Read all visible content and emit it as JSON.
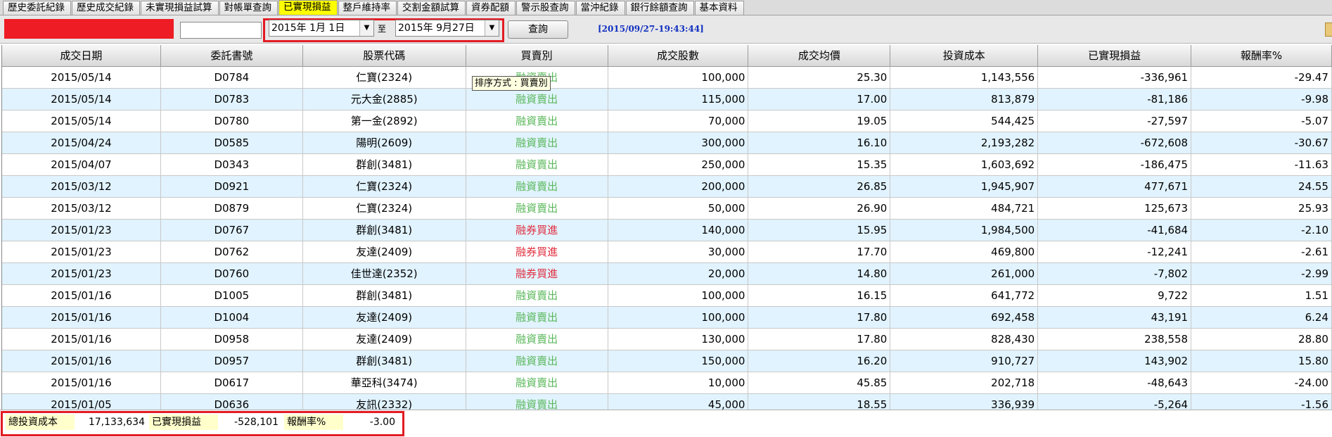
{
  "tabs": [
    {
      "label": "歷史委託紀錄",
      "active": false
    },
    {
      "label": "歷史成交紀錄",
      "active": false
    },
    {
      "label": "未實現損益試算",
      "active": false
    },
    {
      "label": "對帳單查詢",
      "active": false
    },
    {
      "label": "已實現損益",
      "active": true
    },
    {
      "label": "整戶維持率",
      "active": false
    },
    {
      "label": "交割金額試算",
      "active": false
    },
    {
      "label": "資券配額",
      "active": false
    },
    {
      "label": "警示股查詢",
      "active": false
    },
    {
      "label": "當沖紀錄",
      "active": false
    },
    {
      "label": "銀行餘額查詢",
      "active": false
    },
    {
      "label": "基本資料",
      "active": false
    }
  ],
  "toolbar": {
    "date_from": "2015年 1月 1日",
    "date_separator": "至",
    "date_to": "2015年 9月27日",
    "query_label": "查詢",
    "timestamp": "[2015/09/27-19:43:44]"
  },
  "columns": [
    "成交日期",
    "委託書號",
    "股票代碼",
    "買賣別",
    "成交股數",
    "成交均價",
    "投資成本",
    "已實現損益",
    "報酬率%"
  ],
  "tooltip": "排序方式 : 買賣別",
  "rows": [
    {
      "date": "2015/05/14",
      "order": "D0784",
      "stock": "仁寶(2324)",
      "side": "融資賣出",
      "side_type": "buy",
      "shares": "100,000",
      "price": "25.30",
      "cost": "1,143,556",
      "pnl": "-336,961",
      "roi": "-29.47"
    },
    {
      "date": "2015/05/14",
      "order": "D0783",
      "stock": "元大金(2885)",
      "side": "融資賣出",
      "side_type": "buy",
      "shares": "115,000",
      "price": "17.00",
      "cost": "813,879",
      "pnl": "-81,186",
      "roi": "-9.98"
    },
    {
      "date": "2015/05/14",
      "order": "D0780",
      "stock": "第一金(2892)",
      "side": "融資賣出",
      "side_type": "buy",
      "shares": "70,000",
      "price": "19.05",
      "cost": "544,425",
      "pnl": "-27,597",
      "roi": "-5.07"
    },
    {
      "date": "2015/04/24",
      "order": "D0585",
      "stock": "陽明(2609)",
      "side": "融資賣出",
      "side_type": "buy",
      "shares": "300,000",
      "price": "16.10",
      "cost": "2,193,282",
      "pnl": "-672,608",
      "roi": "-30.67"
    },
    {
      "date": "2015/04/07",
      "order": "D0343",
      "stock": "群創(3481)",
      "side": "融資賣出",
      "side_type": "buy",
      "shares": "250,000",
      "price": "15.35",
      "cost": "1,603,692",
      "pnl": "-186,475",
      "roi": "-11.63"
    },
    {
      "date": "2015/03/12",
      "order": "D0921",
      "stock": "仁寶(2324)",
      "side": "融資賣出",
      "side_type": "buy",
      "shares": "200,000",
      "price": "26.85",
      "cost": "1,945,907",
      "pnl": "477,671",
      "roi": "24.55"
    },
    {
      "date": "2015/03/12",
      "order": "D0879",
      "stock": "仁寶(2324)",
      "side": "融資賣出",
      "side_type": "buy",
      "shares": "50,000",
      "price": "26.90",
      "cost": "484,721",
      "pnl": "125,673",
      "roi": "25.93"
    },
    {
      "date": "2015/01/23",
      "order": "D0767",
      "stock": "群創(3481)",
      "side": "融券買進",
      "side_type": "sell",
      "shares": "140,000",
      "price": "15.95",
      "cost": "1,984,500",
      "pnl": "-41,684",
      "roi": "-2.10"
    },
    {
      "date": "2015/01/23",
      "order": "D0762",
      "stock": "友達(2409)",
      "side": "融券買進",
      "side_type": "sell",
      "shares": "30,000",
      "price": "17.70",
      "cost": "469,800",
      "pnl": "-12,241",
      "roi": "-2.61"
    },
    {
      "date": "2015/01/23",
      "order": "D0760",
      "stock": "佳世達(2352)",
      "side": "融券買進",
      "side_type": "sell",
      "shares": "20,000",
      "price": "14.80",
      "cost": "261,000",
      "pnl": "-7,802",
      "roi": "-2.99"
    },
    {
      "date": "2015/01/16",
      "order": "D1005",
      "stock": "群創(3481)",
      "side": "融資賣出",
      "side_type": "buy",
      "shares": "100,000",
      "price": "16.15",
      "cost": "641,772",
      "pnl": "9,722",
      "roi": "1.51"
    },
    {
      "date": "2015/01/16",
      "order": "D1004",
      "stock": "友達(2409)",
      "side": "融資賣出",
      "side_type": "buy",
      "shares": "100,000",
      "price": "17.80",
      "cost": "692,458",
      "pnl": "43,191",
      "roi": "6.24"
    },
    {
      "date": "2015/01/16",
      "order": "D0958",
      "stock": "友達(2409)",
      "side": "融資賣出",
      "side_type": "buy",
      "shares": "130,000",
      "price": "17.80",
      "cost": "828,430",
      "pnl": "238,558",
      "roi": "28.80"
    },
    {
      "date": "2015/01/16",
      "order": "D0957",
      "stock": "群創(3481)",
      "side": "融資賣出",
      "side_type": "buy",
      "shares": "150,000",
      "price": "16.20",
      "cost": "910,727",
      "pnl": "143,902",
      "roi": "15.80"
    },
    {
      "date": "2015/01/16",
      "order": "D0617",
      "stock": "華亞科(3474)",
      "side": "融資賣出",
      "side_type": "buy",
      "shares": "10,000",
      "price": "45.85",
      "cost": "202,718",
      "pnl": "-48,643",
      "roi": "-24.00"
    },
    {
      "date": "2015/01/05",
      "order": "D0636",
      "stock": "友訊(2332)",
      "side": "融資賣出",
      "side_type": "buy",
      "shares": "45,000",
      "price": "18.55",
      "cost": "336,939",
      "pnl": "-5,264",
      "roi": "-1.56"
    }
  ],
  "summary": {
    "total_cost_label": "總投資成本",
    "total_cost": "17,133,634",
    "realized_label": "已實現損益",
    "realized": "-528,101",
    "roi_label": "報酬率%",
    "roi": "-3.00"
  },
  "colors": {
    "active_tab": "#ffff00",
    "highlight_frame": "#e31b23",
    "alt_row": "#e1f3ff",
    "buy_text": "#5bb85b",
    "sell_text": "#e03040",
    "timestamp": "#1030c0"
  }
}
